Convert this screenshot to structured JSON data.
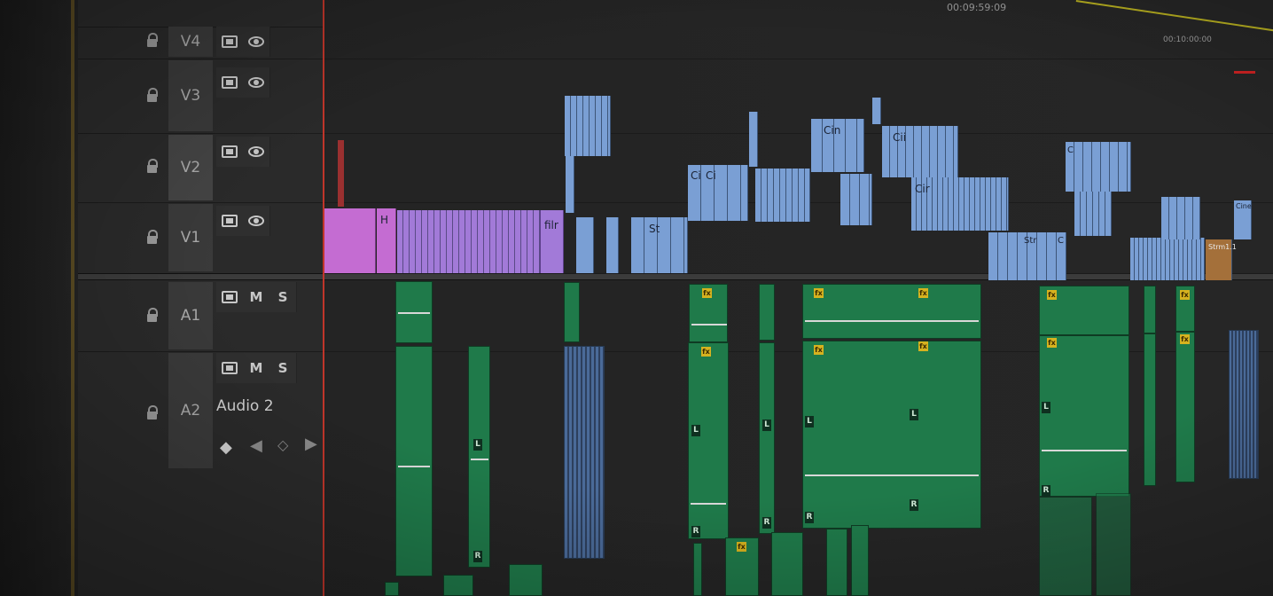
{
  "timeline": {
    "timecode_1": "00:09:59:09",
    "timecode_2": "00:10:00:00"
  },
  "tracks": {
    "v4": {
      "name": "V4"
    },
    "v3": {
      "name": "V3"
    },
    "v2": {
      "name": "V2"
    },
    "v1": {
      "name": "V1"
    },
    "a1": {
      "name": "A1",
      "mute": "M",
      "solo": "S"
    },
    "a2": {
      "name": "A2",
      "mute": "M",
      "solo": "S",
      "label": "Audio 2"
    }
  },
  "clip_labels": {
    "v1_h": "H",
    "v1_filr": "filr",
    "v1_st": "St",
    "v2_ci1": "Ci",
    "v2_ci2": "Ci",
    "v2_cir": "Cir",
    "v2_c": "C",
    "v3_cin": "Cin",
    "v3_cii": "Cii",
    "v1_str": "Str",
    "v1_c2": "C",
    "v1_strm": "Strm1.1",
    "v1_cine": "Cine"
  },
  "badges": {
    "fx": "fx",
    "left": "L",
    "right": "R"
  },
  "colors": {
    "video_clip": "#7a9fd4",
    "video_clip_pink": "#c46cd2",
    "audio_clip": "#1f7a4a",
    "playhead": "#c0352a",
    "ruler_in_out": "#b8b020"
  },
  "icons": [
    "lock-icon",
    "film-icon",
    "eye-icon",
    "add-keyframe-icon",
    "prev-keyframe-icon",
    "keyframe-icon",
    "next-keyframe-icon"
  ]
}
